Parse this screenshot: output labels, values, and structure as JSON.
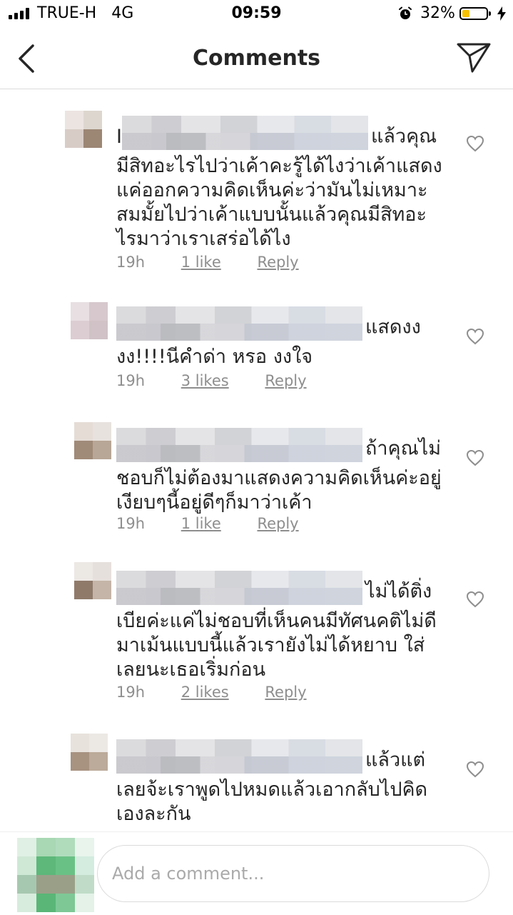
{
  "status_bar": {
    "carrier": "TRUE-H",
    "network": "4G",
    "time": "09:59",
    "battery_percent": "32%",
    "battery_level": 0.32
  },
  "nav": {
    "title": "Comments",
    "back_icon": "chevron-left-icon",
    "share_icon": "send-icon"
  },
  "comments": [
    {
      "prefix": "I",
      "text": "แล้วคุณมีสิทอะไรไปว่าเค้าคะรู้ได้ไงว่าเค้าแสดงแค่ออกความคิดเห็นค่ะว่ามันไม่เหมาะสมมั้ยไปว่าเค้าแบบนั้นแล้วคุณมีสิทอะไรมาว่าเราเสร่อได้ไง",
      "time": "19h",
      "likes": "1 like",
      "reply": "Reply"
    },
    {
      "prefix": "",
      "text": "แสดงงงง!!!!นีคำด่า หรอ งงใจ",
      "time": "19h",
      "likes": "3 likes",
      "reply": "Reply"
    },
    {
      "prefix": "",
      "text": "ถ้าคุณไม่ชอบก็ไม่ต้องมาแสดงความคิดเห็นค่ะอยู่เงียบๆนี้อยู่ดีๆก็มาว่าเค้า",
      "time": "19h",
      "likes": "1 like",
      "reply": "Reply"
    },
    {
      "prefix": "",
      "text": "ไม่ได้ติ่งเบียค่ะแค่ไม่ชอบที่เห็นคนมีทัศนคติไม่ดีมาเม้นแบบนี้แล้วเรายังไม่ได้หยาบ ใส่เลยนะเธอเริ่มก่อน",
      "time": "19h",
      "likes": "2 likes",
      "reply": "Reply"
    },
    {
      "prefix": "",
      "text": "แล้วแต่เลยจ้ะเราพูดไปหมดแล้วเอากลับไปคิดเองละกัน",
      "time": "",
      "likes": "",
      "reply": ""
    }
  ],
  "composer": {
    "placeholder": "Add a comment..."
  },
  "colors": {
    "text": "#262626",
    "meta": "#8e8e8e",
    "battery": "#f7c300"
  }
}
